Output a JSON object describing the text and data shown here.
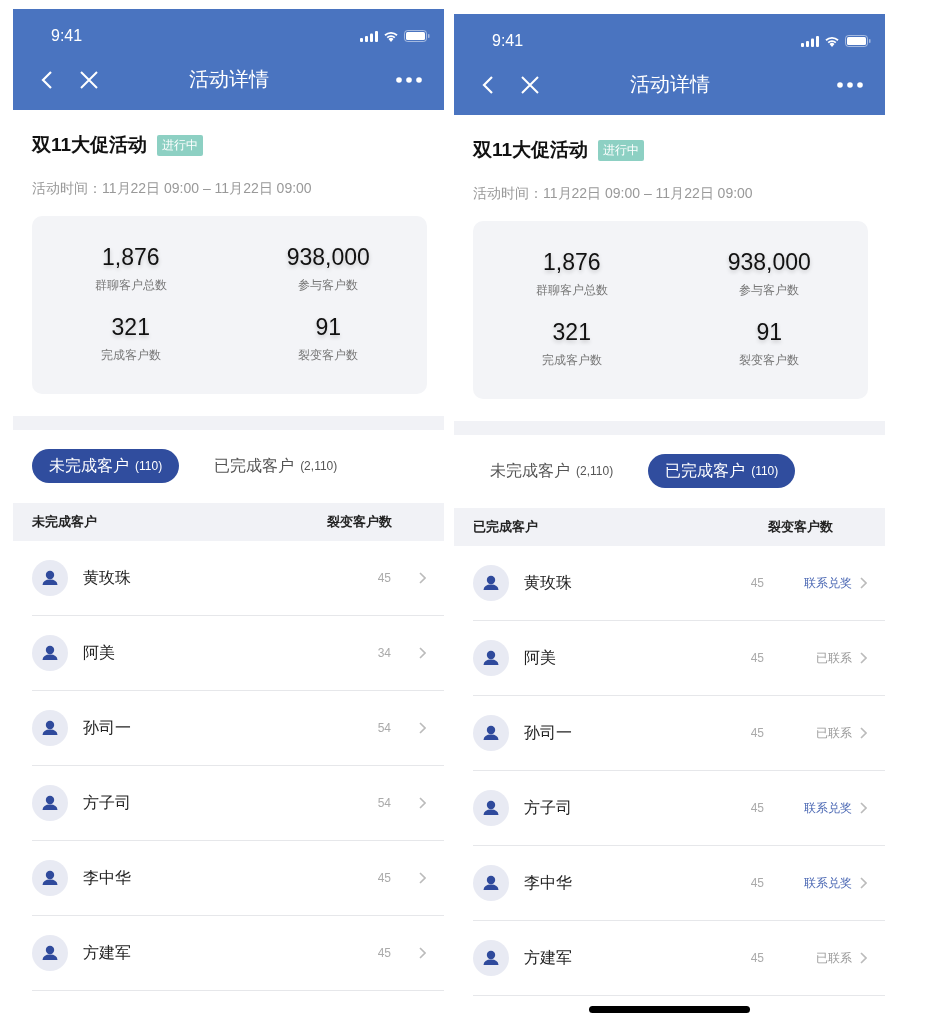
{
  "screens": [
    {
      "status_time": "9:41",
      "nav_title": "活动详情",
      "event_title": "双11大促活动",
      "badge": "进行中",
      "time_text": "活动时间：11月22日 09:00 – 11月22日 09:00",
      "stats": [
        {
          "value": "1,876",
          "label": "群聊客户总数"
        },
        {
          "value": "938,000",
          "label": "参与客户数"
        },
        {
          "value": "321",
          "label": "完成客户数"
        },
        {
          "value": "91",
          "label": "裂变客户数"
        }
      ],
      "tabs": [
        {
          "label": "未完成客户",
          "count": "(110)",
          "selected": true
        },
        {
          "label": "已完成客户",
          "count": "(2,110)",
          "selected": false
        }
      ],
      "columns": [
        "未完成客户",
        "裂变客户数"
      ],
      "rows": [
        {
          "name": "黄玫珠",
          "count": "45"
        },
        {
          "name": "阿美",
          "count": "34"
        },
        {
          "name": "孙司一",
          "count": "54"
        },
        {
          "name": "方子司",
          "count": "54"
        },
        {
          "name": "李中华",
          "count": "45"
        },
        {
          "name": "方建军",
          "count": "45"
        }
      ]
    },
    {
      "status_time": "9:41",
      "nav_title": "活动详情",
      "event_title": "双11大促活动",
      "badge": "进行中",
      "time_text": "活动时间：11月22日 09:00 – 11月22日 09:00",
      "stats": [
        {
          "value": "1,876",
          "label": "群聊客户总数"
        },
        {
          "value": "938,000",
          "label": "参与客户数"
        },
        {
          "value": "321",
          "label": "完成客户数"
        },
        {
          "value": "91",
          "label": "裂变客户数"
        }
      ],
      "tabs": [
        {
          "label": "未完成客户",
          "count": "(2,110)",
          "selected": false
        },
        {
          "label": "已完成客户",
          "count": "(110)",
          "selected": true
        }
      ],
      "columns": [
        "已完成客户",
        "裂变客户数"
      ],
      "rows": [
        {
          "name": "黄玫珠",
          "count": "45",
          "action": {
            "kind": "link",
            "text": "联系兑奖"
          }
        },
        {
          "name": "阿美",
          "count": "45",
          "action": {
            "kind": "done",
            "text": "已联系"
          }
        },
        {
          "name": "孙司一",
          "count": "45",
          "action": {
            "kind": "done",
            "text": "已联系"
          }
        },
        {
          "name": "方子司",
          "count": "45",
          "action": {
            "kind": "link",
            "text": "联系兑奖"
          }
        },
        {
          "name": "李中华",
          "count": "45",
          "action": {
            "kind": "link",
            "text": "联系兑奖"
          }
        },
        {
          "name": "方建军",
          "count": "45",
          "action": {
            "kind": "done",
            "text": "已联系"
          }
        }
      ],
      "home_indicator": true
    }
  ]
}
